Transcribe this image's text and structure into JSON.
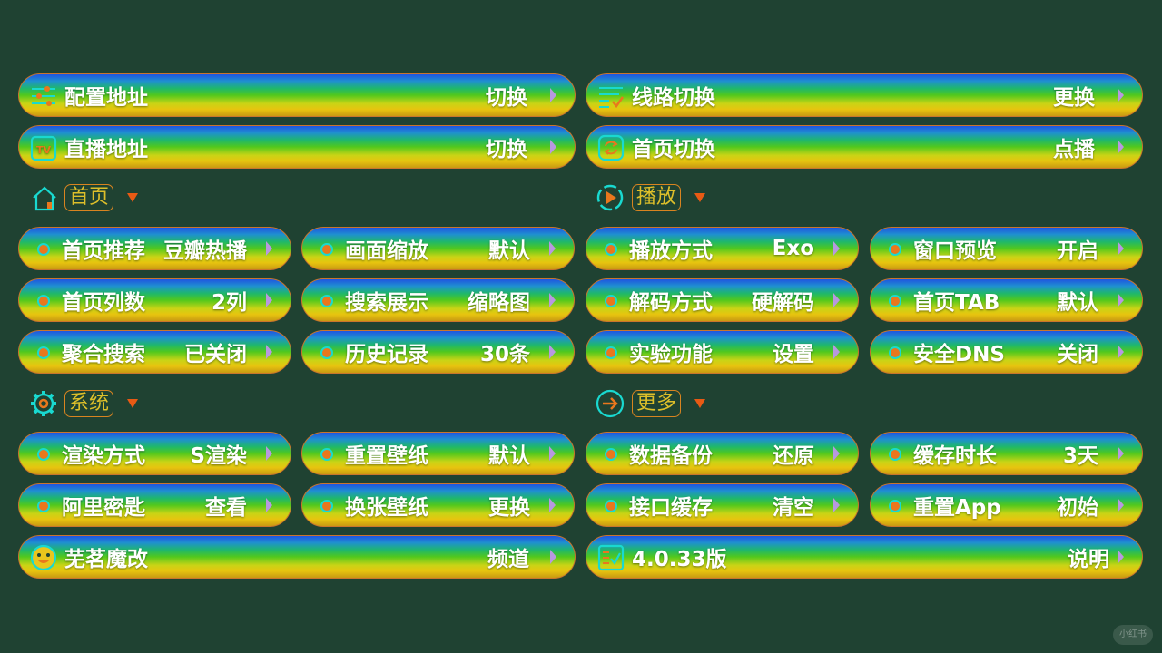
{
  "top_rows": [
    {
      "label": "配置地址",
      "value": "切换",
      "icon": "settings-sliders-icon"
    },
    {
      "label": "线路切换",
      "value": "更换",
      "icon": "route-list-icon"
    },
    {
      "label": "直播地址",
      "value": "切换",
      "icon": "tv-icon"
    },
    {
      "label": "首页切换",
      "value": "点播",
      "icon": "swap-icon"
    }
  ],
  "sections": {
    "home": {
      "title": "首页",
      "icon": "home-icon"
    },
    "play": {
      "title": "播放",
      "icon": "play-circle-icon"
    },
    "system": {
      "title": "系统",
      "icon": "gear-icon"
    },
    "more": {
      "title": "更多",
      "icon": "arrow-circle-icon"
    }
  },
  "home_items": [
    {
      "label": "首页推荐",
      "value": "豆瓣热播"
    },
    {
      "label": "画面缩放",
      "value": "默认"
    },
    {
      "label": "首页列数",
      "value": "2列"
    },
    {
      "label": "搜索展示",
      "value": "缩略图"
    },
    {
      "label": "聚合搜索",
      "value": "已关闭"
    },
    {
      "label": "历史记录",
      "value": "30条"
    }
  ],
  "play_items": [
    {
      "label": "播放方式",
      "value": "Exo"
    },
    {
      "label": "窗口预览",
      "value": "开启"
    },
    {
      "label": "解码方式",
      "value": "硬解码"
    },
    {
      "label": "首页TAB",
      "value": "默认"
    },
    {
      "label": "实验功能",
      "value": "设置"
    },
    {
      "label": "安全DNS",
      "value": "关闭"
    }
  ],
  "system_items": [
    {
      "label": "渲染方式",
      "value": "S渲染"
    },
    {
      "label": "重置壁纸",
      "value": "默认"
    },
    {
      "label": "阿里密匙",
      "value": "查看"
    },
    {
      "label": "换张壁纸",
      "value": "更换"
    }
  ],
  "more_items": [
    {
      "label": "数据备份",
      "value": "还原"
    },
    {
      "label": "缓存时长",
      "value": "3天"
    },
    {
      "label": "接口缓存",
      "value": "清空"
    },
    {
      "label": "重置App",
      "value": "初始"
    }
  ],
  "bottom_rows": [
    {
      "label": "芜茗魔改",
      "value": "频道",
      "icon": "smiley-icon"
    },
    {
      "label": "4.0.33版",
      "value": "说明",
      "icon": "checklist-icon"
    }
  ],
  "watermark": "小红书",
  "colors": {
    "background": "#1f4232",
    "pill_border": "#c9752c",
    "accent_orange": "#e85a14",
    "accent_cyan": "#19d9d0",
    "section_text": "#ddbf2a"
  }
}
